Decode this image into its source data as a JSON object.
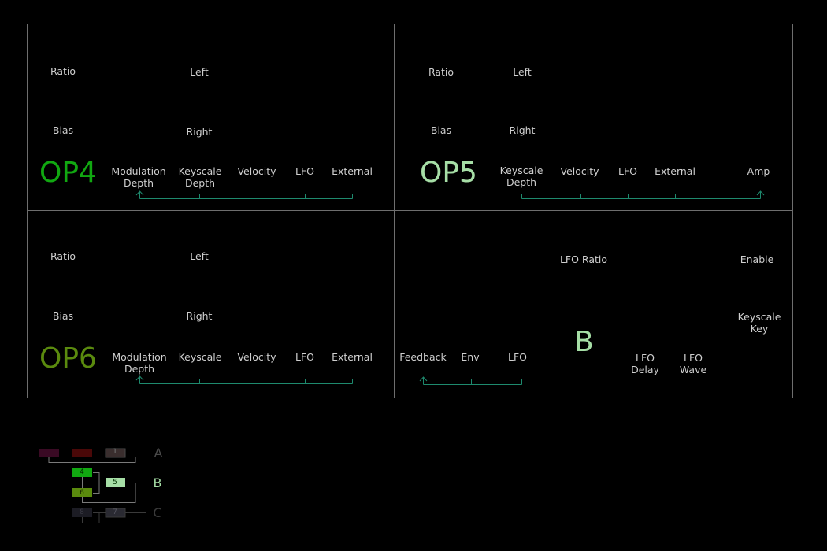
{
  "colors": {
    "op4": "#11a811",
    "op5": "#a6dea6",
    "op6": "#5a8a0e",
    "b": "#a6dea6",
    "routing_line": "#1e8a6e",
    "panel_border": "#6e6e6e"
  },
  "op4": {
    "title": "OP4",
    "ratio": "Ratio",
    "bias": "Bias",
    "left": "Left",
    "right": "Right",
    "mod_depth": "Modulation\nDepth",
    "keyscale_depth": "Keyscale\nDepth",
    "velocity": "Velocity",
    "lfo": "LFO",
    "external": "External"
  },
  "op5": {
    "title": "OP5",
    "ratio": "Ratio",
    "bias": "Bias",
    "left": "Left",
    "right": "Right",
    "keyscale_depth": "Keyscale\nDepth",
    "velocity": "Velocity",
    "lfo": "LFO",
    "external": "External",
    "amp": "Amp"
  },
  "op6": {
    "title": "OP6",
    "ratio": "Ratio",
    "bias": "Bias",
    "left": "Left",
    "right": "Right",
    "mod_depth": "Modulation\nDepth",
    "keyscale": "Keyscale",
    "velocity": "Velocity",
    "lfo": "LFO",
    "external": "External"
  },
  "group_b": {
    "title": "B",
    "lfo_ratio": "LFO Ratio",
    "enable": "Enable",
    "keyscale_key": "Keyscale\nKey",
    "feedback": "Feedback",
    "env": "Env",
    "lfo": "LFO",
    "lfo_delay": "LFO\nDelay",
    "lfo_wave": "LFO\nWave"
  },
  "algorithm": {
    "group_a_label": "A",
    "group_b_label": "B",
    "group_c_label": "C",
    "op1": "1",
    "op4": "4",
    "op5": "5",
    "op6": "6",
    "op7": "7",
    "op8": "8"
  }
}
